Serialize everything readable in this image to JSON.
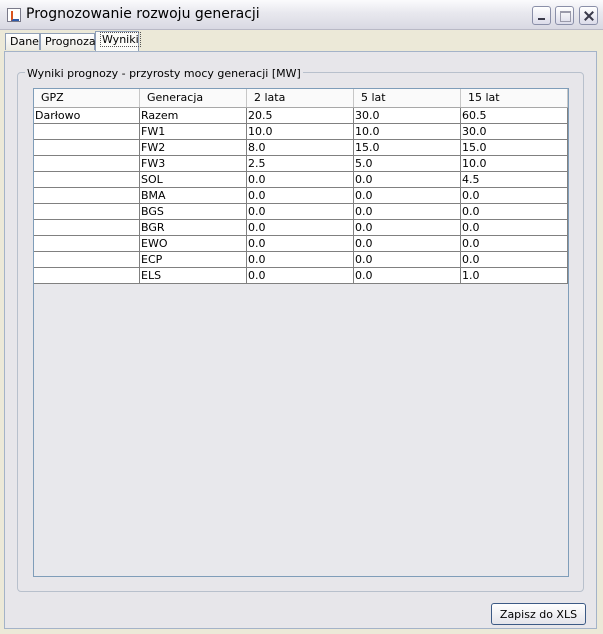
{
  "window": {
    "title": "Prognozowanie rozwoju generacji"
  },
  "tabs": [
    {
      "label": "Dane"
    },
    {
      "label": "Prognoza"
    },
    {
      "label": "Wyniki"
    }
  ],
  "active_tab": "Wyniki",
  "group": {
    "title": "Wyniki prognozy - przyrosty mocy generacji [MW]"
  },
  "table": {
    "headers": [
      "GPZ",
      "Generacja",
      "2 lata",
      "5 lat",
      "15 lat"
    ],
    "rows": [
      [
        "Darłowo",
        "Razem",
        "20.5",
        "30.0",
        "60.5"
      ],
      [
        "",
        "FW1",
        "10.0",
        "10.0",
        "30.0"
      ],
      [
        "",
        "FW2",
        "8.0",
        "15.0",
        "15.0"
      ],
      [
        "",
        "FW3",
        "2.5",
        "5.0",
        "10.0"
      ],
      [
        "",
        "SOL",
        "0.0",
        "0.0",
        "4.5"
      ],
      [
        "",
        "BMA",
        "0.0",
        "0.0",
        "0.0"
      ],
      [
        "",
        "BGS",
        "0.0",
        "0.0",
        "0.0"
      ],
      [
        "",
        "BGR",
        "0.0",
        "0.0",
        "0.0"
      ],
      [
        "",
        "EWO",
        "0.0",
        "0.0",
        "0.0"
      ],
      [
        "",
        "ECP",
        "0.0",
        "0.0",
        "0.0"
      ],
      [
        "",
        "ELS",
        "0.0",
        "0.0",
        "1.0"
      ]
    ]
  },
  "buttons": {
    "save_xls": "Zapisz do XLS"
  }
}
